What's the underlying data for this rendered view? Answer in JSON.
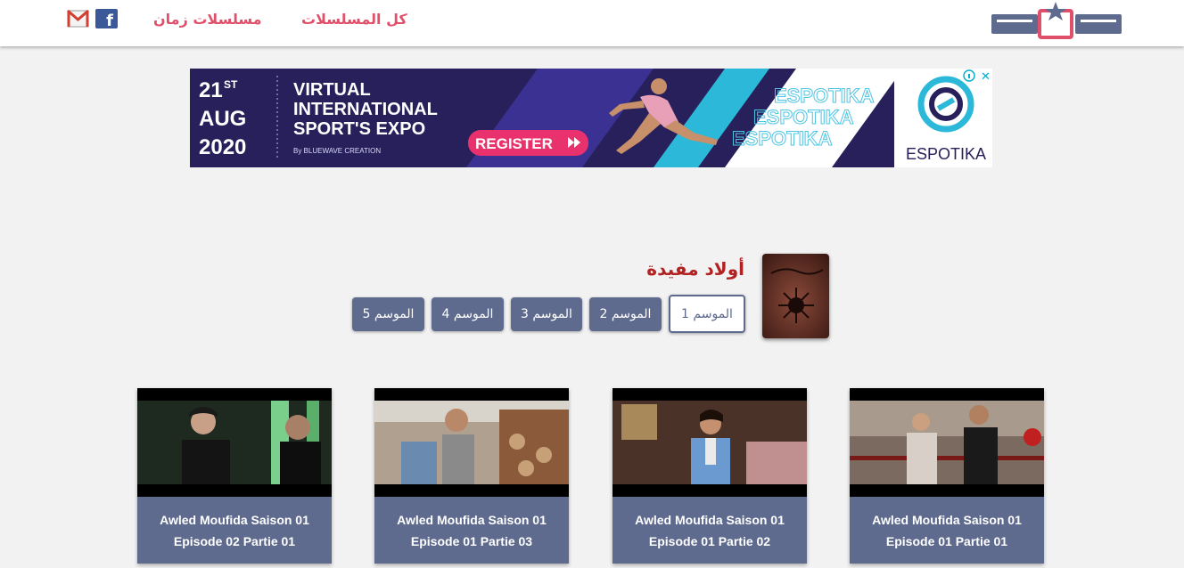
{
  "header": {
    "logo_alt": "تونسي",
    "nav": [
      {
        "label": "كل المسلسلات"
      },
      {
        "label": "مسلسلات زمان"
      }
    ],
    "social": [
      {
        "icon": "facebook-icon",
        "glyph": "f"
      },
      {
        "icon": "gmail-icon"
      }
    ]
  },
  "ad": {
    "date_day": "21",
    "date_suffix": "ST",
    "date_month": "AUG",
    "date_year": "2020",
    "headline_1": "VIRTUAL",
    "headline_2": "INTERNATIONAL",
    "headline_3": "SPORT'S EXPO",
    "byline": "By BLUEWAVE CREATION",
    "cta": "REGISTER",
    "brand_watermark": "ESPOTIKA",
    "brand": "ESPOTIKA"
  },
  "series": {
    "title": "أولاد مفيدة",
    "seasons": [
      {
        "label": "الموسم 1",
        "active": true
      },
      {
        "label": "الموسم 2",
        "active": false
      },
      {
        "label": "الموسم 3",
        "active": false
      },
      {
        "label": "الموسم 4",
        "active": false
      },
      {
        "label": "الموسم 5",
        "active": false
      }
    ]
  },
  "episodes": [
    {
      "line1": "Awled Moufida Saison 01",
      "line2": "Episode 01 Partie 01"
    },
    {
      "line1": "Awled Moufida Saison 01",
      "line2": "Episode 01 Partie 02"
    },
    {
      "line1": "Awled Moufida Saison 01",
      "line2": "Episode 01 Partie 03"
    },
    {
      "line1": "Awled Moufida Saison 01",
      "line2": "Episode 02 Partie 01"
    }
  ],
  "colors": {
    "accent": "#e0506a",
    "title": "#b22222",
    "button": "#5e6a8e",
    "ad_bg": "#27205a",
    "ad_cyan": "#2bb8d9",
    "ad_pink": "#e8316d"
  }
}
